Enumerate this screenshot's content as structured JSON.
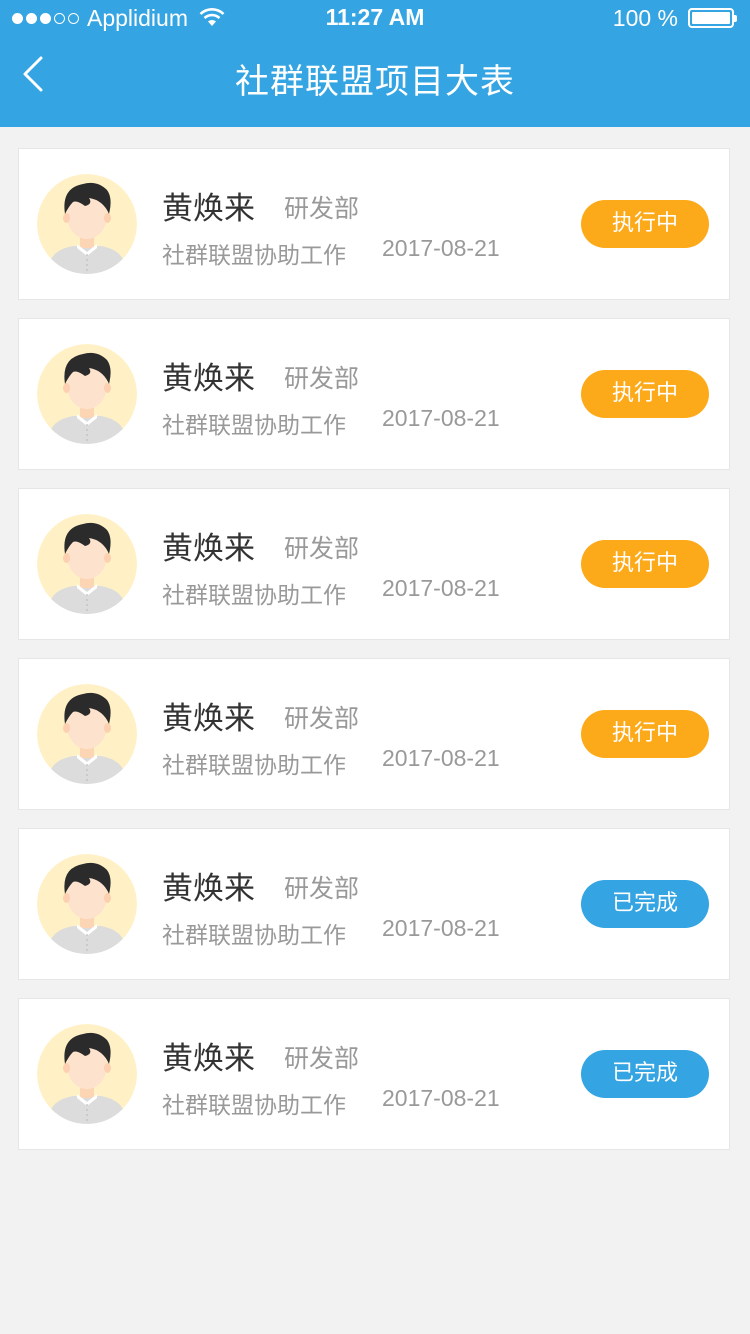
{
  "status_bar": {
    "carrier": "Applidium",
    "time": "11:27 AM",
    "battery": "100 %",
    "signal_icon": "signal-dots-icon",
    "wifi_icon": "wifi-icon",
    "battery_icon": "battery-icon"
  },
  "header": {
    "title": "社群联盟项目大表",
    "back_icon": "chevron-left-icon"
  },
  "colors": {
    "header_bg": "#34a4e2",
    "in_progress": "#fdaa1a",
    "completed": "#34a4e2",
    "avatar_bg": "#fff1c5"
  },
  "projects": [
    {
      "name": "黄焕来",
      "department": "研发部",
      "description": "社群联盟协助工作",
      "date": "2017-08-21",
      "status": "执行中",
      "status_type": "in_progress"
    },
    {
      "name": "黄焕来",
      "department": "研发部",
      "description": "社群联盟协助工作",
      "date": "2017-08-21",
      "status": "执行中",
      "status_type": "in_progress"
    },
    {
      "name": "黄焕来",
      "department": "研发部",
      "description": "社群联盟协助工作",
      "date": "2017-08-21",
      "status": "执行中",
      "status_type": "in_progress"
    },
    {
      "name": "黄焕来",
      "department": "研发部",
      "description": "社群联盟协助工作",
      "date": "2017-08-21",
      "status": "执行中",
      "status_type": "in_progress"
    },
    {
      "name": "黄焕来",
      "department": "研发部",
      "description": "社群联盟协助工作",
      "date": "2017-08-21",
      "status": "已完成",
      "status_type": "completed"
    },
    {
      "name": "黄焕来",
      "department": "研发部",
      "description": "社群联盟协助工作",
      "date": "2017-08-21",
      "status": "已完成",
      "status_type": "completed"
    }
  ]
}
